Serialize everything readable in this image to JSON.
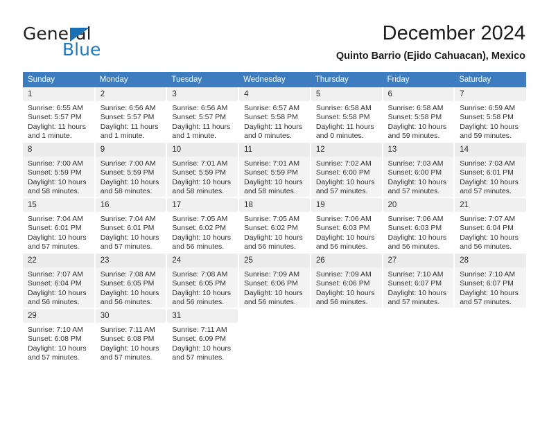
{
  "brand": {
    "name_top": "General",
    "name_bottom": "Blue",
    "triangle_icon": "brand-triangle-icon",
    "color_top": "#231f20",
    "color_bottom": "#1b7ac4"
  },
  "header": {
    "month_title": "December 2024",
    "location": "Quinto Barrio (Ejido Cahuacan), Mexico"
  },
  "calendar": {
    "header_bg": "#3d7dbf",
    "header_text_color": "#ffffff",
    "weekdays": [
      "Sunday",
      "Monday",
      "Tuesday",
      "Wednesday",
      "Thursday",
      "Friday",
      "Saturday"
    ],
    "weeks": [
      [
        {
          "day": "1",
          "sunrise": "Sunrise: 6:55 AM",
          "sunset": "Sunset: 5:57 PM",
          "daylight1": "Daylight: 11 hours",
          "daylight2": "and 1 minute."
        },
        {
          "day": "2",
          "sunrise": "Sunrise: 6:56 AM",
          "sunset": "Sunset: 5:57 PM",
          "daylight1": "Daylight: 11 hours",
          "daylight2": "and 1 minute."
        },
        {
          "day": "3",
          "sunrise": "Sunrise: 6:56 AM",
          "sunset": "Sunset: 5:57 PM",
          "daylight1": "Daylight: 11 hours",
          "daylight2": "and 1 minute."
        },
        {
          "day": "4",
          "sunrise": "Sunrise: 6:57 AM",
          "sunset": "Sunset: 5:58 PM",
          "daylight1": "Daylight: 11 hours",
          "daylight2": "and 0 minutes."
        },
        {
          "day": "5",
          "sunrise": "Sunrise: 6:58 AM",
          "sunset": "Sunset: 5:58 PM",
          "daylight1": "Daylight: 11 hours",
          "daylight2": "and 0 minutes."
        },
        {
          "day": "6",
          "sunrise": "Sunrise: 6:58 AM",
          "sunset": "Sunset: 5:58 PM",
          "daylight1": "Daylight: 10 hours",
          "daylight2": "and 59 minutes."
        },
        {
          "day": "7",
          "sunrise": "Sunrise: 6:59 AM",
          "sunset": "Sunset: 5:58 PM",
          "daylight1": "Daylight: 10 hours",
          "daylight2": "and 59 minutes."
        }
      ],
      [
        {
          "day": "8",
          "sunrise": "Sunrise: 7:00 AM",
          "sunset": "Sunset: 5:59 PM",
          "daylight1": "Daylight: 10 hours",
          "daylight2": "and 58 minutes."
        },
        {
          "day": "9",
          "sunrise": "Sunrise: 7:00 AM",
          "sunset": "Sunset: 5:59 PM",
          "daylight1": "Daylight: 10 hours",
          "daylight2": "and 58 minutes."
        },
        {
          "day": "10",
          "sunrise": "Sunrise: 7:01 AM",
          "sunset": "Sunset: 5:59 PM",
          "daylight1": "Daylight: 10 hours",
          "daylight2": "and 58 minutes."
        },
        {
          "day": "11",
          "sunrise": "Sunrise: 7:01 AM",
          "sunset": "Sunset: 5:59 PM",
          "daylight1": "Daylight: 10 hours",
          "daylight2": "and 58 minutes."
        },
        {
          "day": "12",
          "sunrise": "Sunrise: 7:02 AM",
          "sunset": "Sunset: 6:00 PM",
          "daylight1": "Daylight: 10 hours",
          "daylight2": "and 57 minutes."
        },
        {
          "day": "13",
          "sunrise": "Sunrise: 7:03 AM",
          "sunset": "Sunset: 6:00 PM",
          "daylight1": "Daylight: 10 hours",
          "daylight2": "and 57 minutes."
        },
        {
          "day": "14",
          "sunrise": "Sunrise: 7:03 AM",
          "sunset": "Sunset: 6:01 PM",
          "daylight1": "Daylight: 10 hours",
          "daylight2": "and 57 minutes."
        }
      ],
      [
        {
          "day": "15",
          "sunrise": "Sunrise: 7:04 AM",
          "sunset": "Sunset: 6:01 PM",
          "daylight1": "Daylight: 10 hours",
          "daylight2": "and 57 minutes."
        },
        {
          "day": "16",
          "sunrise": "Sunrise: 7:04 AM",
          "sunset": "Sunset: 6:01 PM",
          "daylight1": "Daylight: 10 hours",
          "daylight2": "and 57 minutes."
        },
        {
          "day": "17",
          "sunrise": "Sunrise: 7:05 AM",
          "sunset": "Sunset: 6:02 PM",
          "daylight1": "Daylight: 10 hours",
          "daylight2": "and 56 minutes."
        },
        {
          "day": "18",
          "sunrise": "Sunrise: 7:05 AM",
          "sunset": "Sunset: 6:02 PM",
          "daylight1": "Daylight: 10 hours",
          "daylight2": "and 56 minutes."
        },
        {
          "day": "19",
          "sunrise": "Sunrise: 7:06 AM",
          "sunset": "Sunset: 6:03 PM",
          "daylight1": "Daylight: 10 hours",
          "daylight2": "and 56 minutes."
        },
        {
          "day": "20",
          "sunrise": "Sunrise: 7:06 AM",
          "sunset": "Sunset: 6:03 PM",
          "daylight1": "Daylight: 10 hours",
          "daylight2": "and 56 minutes."
        },
        {
          "day": "21",
          "sunrise": "Sunrise: 7:07 AM",
          "sunset": "Sunset: 6:04 PM",
          "daylight1": "Daylight: 10 hours",
          "daylight2": "and 56 minutes."
        }
      ],
      [
        {
          "day": "22",
          "sunrise": "Sunrise: 7:07 AM",
          "sunset": "Sunset: 6:04 PM",
          "daylight1": "Daylight: 10 hours",
          "daylight2": "and 56 minutes."
        },
        {
          "day": "23",
          "sunrise": "Sunrise: 7:08 AM",
          "sunset": "Sunset: 6:05 PM",
          "daylight1": "Daylight: 10 hours",
          "daylight2": "and 56 minutes."
        },
        {
          "day": "24",
          "sunrise": "Sunrise: 7:08 AM",
          "sunset": "Sunset: 6:05 PM",
          "daylight1": "Daylight: 10 hours",
          "daylight2": "and 56 minutes."
        },
        {
          "day": "25",
          "sunrise": "Sunrise: 7:09 AM",
          "sunset": "Sunset: 6:06 PM",
          "daylight1": "Daylight: 10 hours",
          "daylight2": "and 56 minutes."
        },
        {
          "day": "26",
          "sunrise": "Sunrise: 7:09 AM",
          "sunset": "Sunset: 6:06 PM",
          "daylight1": "Daylight: 10 hours",
          "daylight2": "and 56 minutes."
        },
        {
          "day": "27",
          "sunrise": "Sunrise: 7:10 AM",
          "sunset": "Sunset: 6:07 PM",
          "daylight1": "Daylight: 10 hours",
          "daylight2": "and 57 minutes."
        },
        {
          "day": "28",
          "sunrise": "Sunrise: 7:10 AM",
          "sunset": "Sunset: 6:07 PM",
          "daylight1": "Daylight: 10 hours",
          "daylight2": "and 57 minutes."
        }
      ],
      [
        {
          "day": "29",
          "sunrise": "Sunrise: 7:10 AM",
          "sunset": "Sunset: 6:08 PM",
          "daylight1": "Daylight: 10 hours",
          "daylight2": "and 57 minutes."
        },
        {
          "day": "30",
          "sunrise": "Sunrise: 7:11 AM",
          "sunset": "Sunset: 6:08 PM",
          "daylight1": "Daylight: 10 hours",
          "daylight2": "and 57 minutes."
        },
        {
          "day": "31",
          "sunrise": "Sunrise: 7:11 AM",
          "sunset": "Sunset: 6:09 PM",
          "daylight1": "Daylight: 10 hours",
          "daylight2": "and 57 minutes."
        },
        {
          "day": "",
          "sunrise": "",
          "sunset": "",
          "daylight1": "",
          "daylight2": ""
        },
        {
          "day": "",
          "sunrise": "",
          "sunset": "",
          "daylight1": "",
          "daylight2": ""
        },
        {
          "day": "",
          "sunrise": "",
          "sunset": "",
          "daylight1": "",
          "daylight2": ""
        },
        {
          "day": "",
          "sunrise": "",
          "sunset": "",
          "daylight1": "",
          "daylight2": ""
        }
      ]
    ]
  }
}
